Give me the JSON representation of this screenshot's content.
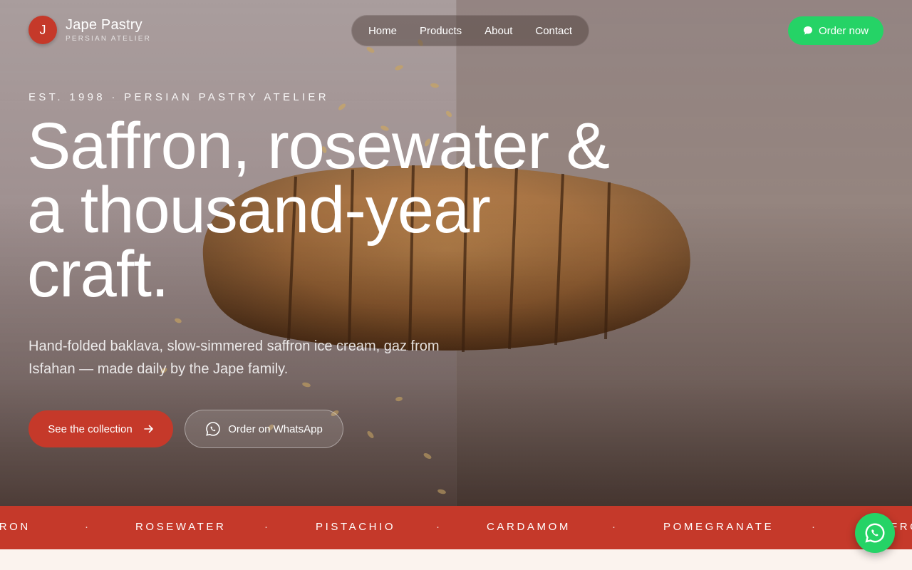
{
  "brand": {
    "logo_letter": "J",
    "name": "Jape Pastry",
    "tagline": "PERSIAN ATELIER",
    "accent": "#c5392a",
    "whatsapp_green": "#25d366"
  },
  "nav": {
    "items": [
      "Home",
      "Products",
      "About",
      "Contact"
    ]
  },
  "header_cta": {
    "label": "Order now",
    "icon": "chat-bubble-icon"
  },
  "hero": {
    "eyebrow": "EST. 1998 · PERSIAN PASTRY ATELIER",
    "headline_line1": "Saffron, rosewater &",
    "headline_line2": "a thousand-year",
    "headline_line3": "craft.",
    "lede": "Hand-folded baklava, slow-simmered saffron ice cream, gaz from Isfahan — made daily by the Jape family.",
    "primary_cta": {
      "label": "See the collection",
      "icon": "arrow-right-icon"
    },
    "secondary_cta": {
      "label": "Order on WhatsApp",
      "icon": "whatsapp-icon"
    }
  },
  "ticker": {
    "items": [
      "SAFFRON",
      "ROSEWATER",
      "PISTACHIO",
      "CARDAMOM",
      "POMEGRANATE",
      "SAFFRON"
    ],
    "separator": "·"
  },
  "floating_button": {
    "icon": "whatsapp-icon"
  }
}
